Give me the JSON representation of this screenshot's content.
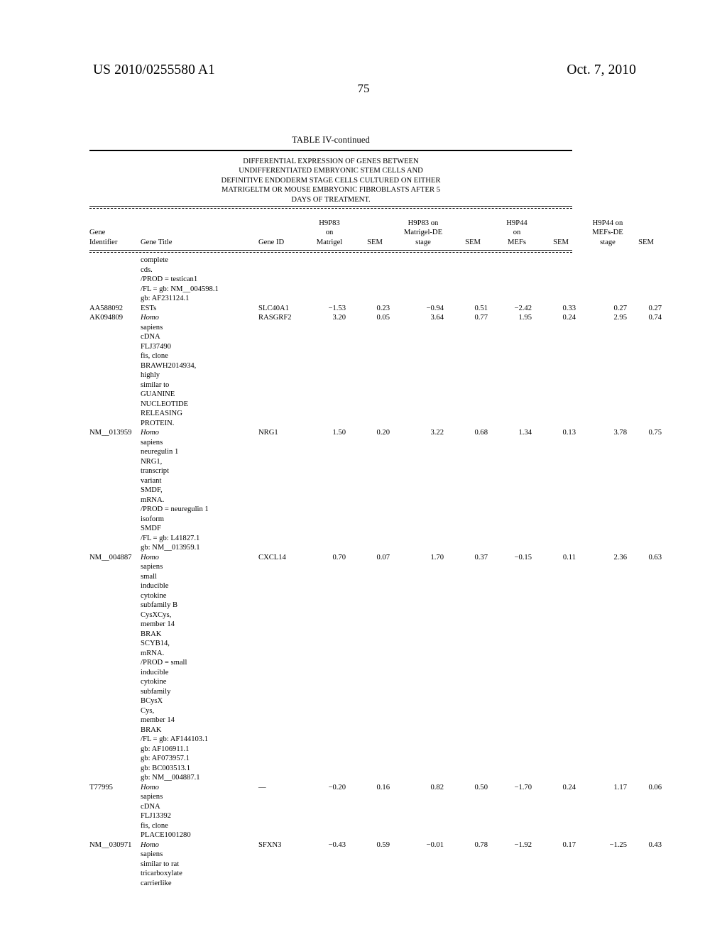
{
  "page": {
    "publication_number": "US 2010/0255580 A1",
    "publication_date": "Oct. 7, 2010",
    "page_number": "75"
  },
  "table": {
    "title": "TABLE IV-continued",
    "caption_lines": [
      "DIFFERENTIAL EXPRESSION OF GENES BETWEEN",
      "UNDIFFERENTIATED EMBRYONIC STEM CELLS AND",
      "DEFINITIVE ENDODERM STAGE CELLS CULTURED ON EITHER",
      "MATRIGELTM OR MOUSE EMBRYONIC FIBROBLASTS AFTER 5",
      "DAYS OF TREATMENT."
    ],
    "columns": [
      {
        "id": "gene_identifier",
        "lines": [
          "Gene",
          "Identifier"
        ]
      },
      {
        "id": "gene_title",
        "lines": [
          "Gene Title"
        ]
      },
      {
        "id": "gene_id",
        "lines": [
          "Gene ID"
        ]
      },
      {
        "id": "h9p83_matrigel",
        "lines": [
          "H9P83",
          "on",
          "Matrigel"
        ]
      },
      {
        "id": "sem1",
        "lines": [
          "SEM"
        ]
      },
      {
        "id": "h9p83_matrigel_de",
        "lines": [
          "H9P83 on",
          "Matrigel-DE",
          "stage"
        ]
      },
      {
        "id": "sem2",
        "lines": [
          "SEM"
        ]
      },
      {
        "id": "h9p44_mefs",
        "lines": [
          "H9P44",
          "on",
          "MEFs"
        ]
      },
      {
        "id": "sem3",
        "lines": [
          "SEM"
        ]
      },
      {
        "id": "h9p44_mefs_de",
        "lines": [
          "H9P44 on",
          "MEFs-DE",
          "stage"
        ]
      },
      {
        "id": "sem4",
        "lines": [
          "SEM"
        ]
      }
    ],
    "continued_title_lines": [
      "complete",
      "cds.",
      "/PROD = testican1",
      "/FL = gb: NM__004598.1",
      "gb: AF231124.1"
    ],
    "rows": [
      {
        "gene_identifier": "AA588092",
        "title_lines": [
          "ESTs"
        ],
        "title_italic_first": false,
        "gene_id": "SLC40A1",
        "values": [
          "−1.53",
          "0.23",
          "−0.94",
          "0.51",
          "−2.42",
          "0.33",
          "0.27",
          "0.27"
        ]
      },
      {
        "gene_identifier": "AK094809",
        "title_lines": [
          "Homo",
          "sapiens",
          "cDNA",
          "FLJ37490",
          "fis, clone",
          "BRAWH2014934,",
          "highly",
          "similar to",
          "GUANINE",
          "NUCLEOTIDE",
          "RELEASING",
          "PROTEIN."
        ],
        "title_italic_first": true,
        "gene_id": "RASGRF2",
        "values": [
          "3.20",
          "0.05",
          "3.64",
          "0.77",
          "1.95",
          "0.24",
          "2.95",
          "0.74"
        ]
      },
      {
        "gene_identifier": "NM__013959",
        "title_lines": [
          "Homo",
          "sapiens",
          "neuregulin 1",
          "NRG1,",
          "transcript",
          "variant",
          "SMDF,",
          "mRNA.",
          "/PROD = neuregulin 1",
          "isoform",
          "SMDF",
          "/FL = gb: L41827.1",
          "gb: NM__013959.1"
        ],
        "title_italic_first": true,
        "gene_id": "NRG1",
        "values": [
          "1.50",
          "0.20",
          "3.22",
          "0.68",
          "1.34",
          "0.13",
          "3.78",
          "0.75"
        ]
      },
      {
        "gene_identifier": "NM__004887",
        "title_lines": [
          "Homo",
          "sapiens",
          "small",
          "inducible",
          "cytokine",
          "subfamily B",
          "CysXCys,",
          "member 14",
          "BRAK",
          "SCYB14,",
          "mRNA.",
          "/PROD = small",
          "inducible",
          "cytokine",
          "subfamily",
          "BCysX",
          "Cys,",
          "member 14",
          "BRAK",
          "/FL = gb: AF144103.1",
          "gb: AF106911.1",
          "gb: AF073957.1",
          "gb: BC003513.1",
          "gb: NM__004887.1"
        ],
        "title_italic_first": true,
        "gene_id": "CXCL14",
        "values": [
          "0.70",
          "0.07",
          "1.70",
          "0.37",
          "−0.15",
          "0.11",
          "2.36",
          "0.63"
        ]
      },
      {
        "gene_identifier": "T77995",
        "title_lines": [
          "Homo",
          "sapiens",
          "cDNA",
          "FLJ13392",
          "fis, clone",
          "PLACE1001280"
        ],
        "title_italic_first": true,
        "gene_id": "—",
        "values": [
          "−0.20",
          "0.16",
          "0.82",
          "0.50",
          "−1.70",
          "0.24",
          "1.17",
          "0.06"
        ]
      },
      {
        "gene_identifier": "NM__030971",
        "title_lines": [
          "Homo",
          "sapiens",
          "similar to rat",
          "tricarboxylate",
          "carrierlike"
        ],
        "title_italic_first": true,
        "gene_id": "SFXN3",
        "values": [
          "−0.43",
          "0.59",
          "−0.01",
          "0.78",
          "−1.92",
          "0.17",
          "−1.25",
          "0.43"
        ]
      }
    ]
  }
}
